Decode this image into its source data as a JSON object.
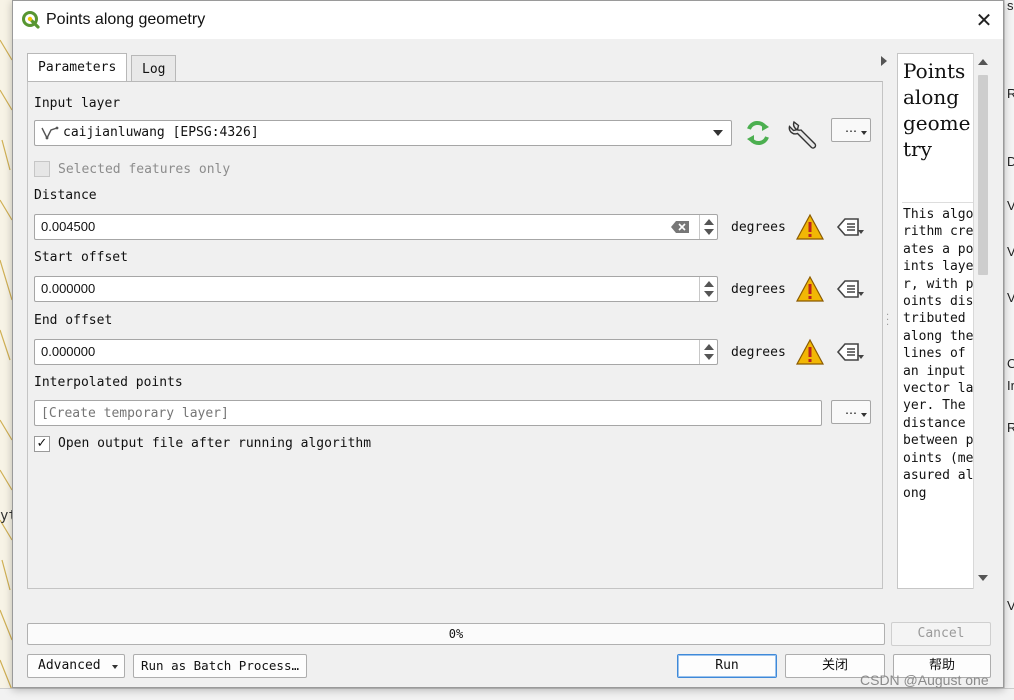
{
  "window": {
    "title": "Points along geometry",
    "close_glyph": "✕"
  },
  "tabs": [
    {
      "label": "Parameters",
      "active": true
    },
    {
      "label": "Log",
      "active": false
    }
  ],
  "params": {
    "input_layer": {
      "label": "Input layer",
      "value": "caijianluwang [EPSG:4326]",
      "layer_icon": "line-layer-icon",
      "more_label": "…"
    },
    "selected_only": {
      "label": "Selected features only",
      "checked": false,
      "enabled": false
    },
    "distance": {
      "label": "Distance",
      "value": "0.004500",
      "unit": "degrees"
    },
    "start_offset": {
      "label": "Start offset",
      "value": "0.000000",
      "unit": "degrees"
    },
    "end_offset": {
      "label": "End offset",
      "value": "0.000000",
      "unit": "degrees"
    },
    "output": {
      "label": "Interpolated points",
      "placeholder": "[Create temporary layer]",
      "more_label": "…"
    },
    "open_output": {
      "label": "Open output file after running algorithm",
      "checked": true,
      "check_glyph": "✓"
    }
  },
  "help": {
    "title": "Points along geometry",
    "body": "This algorithm creates a points layer, with points distributed along the lines of an input vector layer. The distance between points (measured along"
  },
  "progress": {
    "value_text": "0%",
    "value": 0
  },
  "buttons": {
    "advanced": "Advanced",
    "batch": "Run as Batch Process…",
    "run": "Run",
    "cancel": "Cancel",
    "close": "关闭",
    "help": "帮助"
  },
  "background": {
    "right_panel_letters": [
      "sl",
      "R",
      "D",
      "V",
      "V",
      "V",
      "O",
      "Ir",
      "R",
      "V"
    ],
    "left_text": "yt",
    "watermark": "CSDN @August one"
  },
  "colors": {
    "accent": "#3f89d8",
    "warning": "#f2b705",
    "refresh_green": "#4caf50",
    "qgis_green": "#589632"
  }
}
